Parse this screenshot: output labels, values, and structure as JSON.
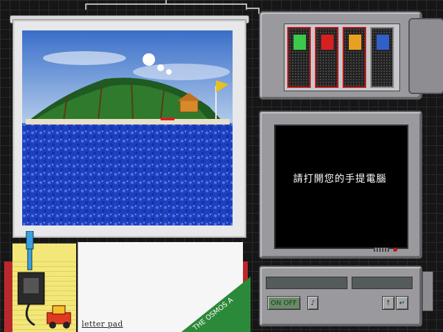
{
  "pad": {
    "label": "letter pad",
    "sticker_text": "THE OSMOS A"
  },
  "screen": {
    "message": "請打開您的手提電腦"
  },
  "controls": {
    "power_label": "ON OFF"
  },
  "colors": {
    "accent_red": "#c01818",
    "screen_bg": "#000000",
    "panel_gray": "#9a9a9e"
  },
  "slots": [
    {
      "icon": "green-face-icon",
      "color": "#3cc84a"
    },
    {
      "icon": "red-face-icon",
      "color": "#d82020"
    },
    {
      "icon": "bus-icon",
      "color": "#e8a020"
    },
    {
      "icon": "document-icon",
      "color": "#3060c8"
    }
  ]
}
